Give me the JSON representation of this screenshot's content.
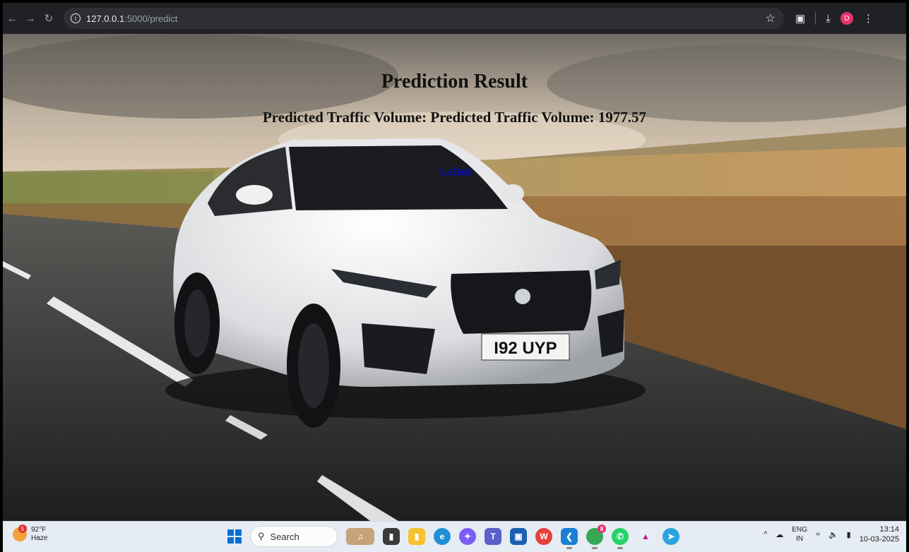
{
  "browser": {
    "url_host": "127.0.0.1",
    "url_rest": ":5000/predict",
    "profile_initial": "D"
  },
  "page": {
    "title": "Prediction Result",
    "result": "Predicted Traffic Volume: Predicted Traffic Volume: 1977.57",
    "back_link": "Go Back",
    "background_image": "white-sedan-on-country-road",
    "license_plate": "I92 UYP"
  },
  "taskbar": {
    "weather_badge": "5",
    "temperature": "92°F",
    "condition": "Haze",
    "search_label": "Search",
    "apps": [
      "file-explorer",
      "task-view",
      "folder",
      "edge",
      "copilot",
      "teams",
      "store",
      "wps-office",
      "vscode",
      "chrome",
      "whatsapp",
      "photos",
      "telegram"
    ],
    "chrome_badge": "8",
    "language": "ENG",
    "region": "IN",
    "time": "13:14",
    "date": "10-03-2025"
  },
  "colors": {
    "chrome_bg": "#202124",
    "link": "#0000ee",
    "taskbar_bg": "#e6ecf3"
  }
}
